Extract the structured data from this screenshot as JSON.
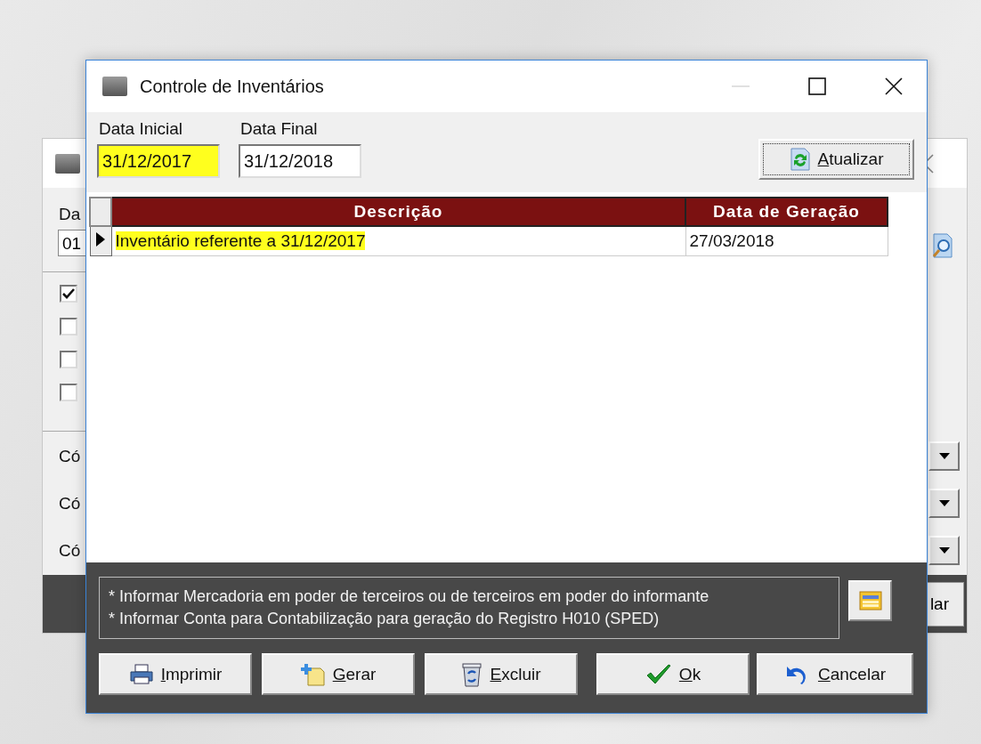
{
  "back_window": {
    "label": "Da",
    "field": "01",
    "checkboxes": [
      {
        "checked": true
      },
      {
        "checked": false
      },
      {
        "checked": false
      },
      {
        "checked": false
      }
    ],
    "combo_labels": [
      "Có",
      "Có",
      "Có"
    ],
    "button": "lar"
  },
  "window": {
    "title": "Controle de Inventários"
  },
  "filters": [
    {
      "label": "Data Inicial",
      "value": "31/12/2017",
      "highlighted": true
    },
    {
      "label": "Data Final",
      "value": "31/12/2018",
      "highlighted": false
    }
  ],
  "refresh_button": "Atualizar",
  "table": {
    "columns": [
      "Descrição",
      "Data de Geração"
    ],
    "rows": [
      {
        "selected": true,
        "highlighted": true,
        "cells": [
          "Inventário referente a 31/12/2017",
          "27/03/2018"
        ]
      }
    ]
  },
  "notes": [
    "* Informar Mercadoria em poder de terceiros ou de terceiros em poder do informante",
    "* Informar Conta para Contabilização para geração do Registro H010 (SPED)"
  ],
  "buttons": [
    {
      "kind": "print",
      "label": "Imprimir"
    },
    {
      "kind": "add",
      "label": "Gerar"
    },
    {
      "kind": "delete",
      "label": "Excluir"
    },
    {
      "kind": "ok",
      "label": "Ok"
    },
    {
      "kind": "cancel",
      "label": "Cancelar"
    }
  ]
}
